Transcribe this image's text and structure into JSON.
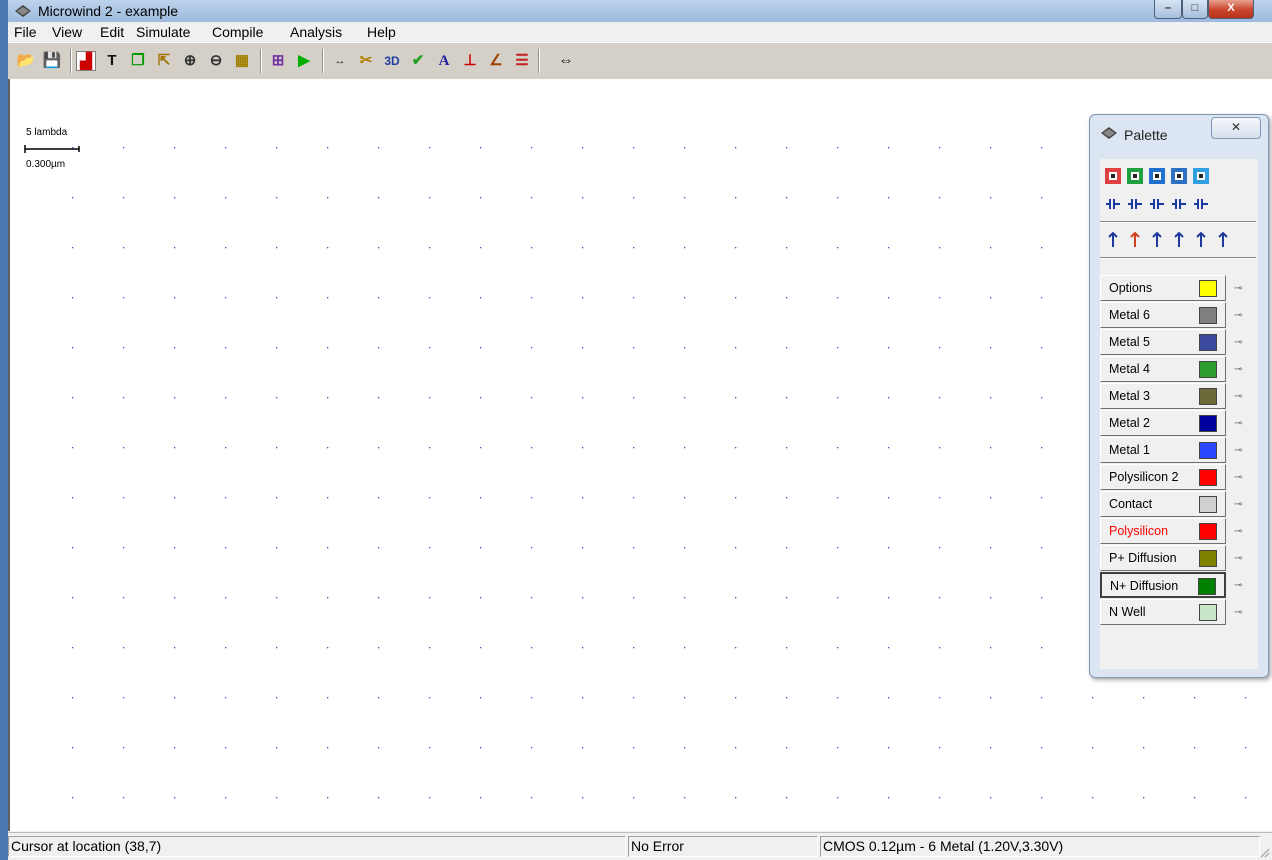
{
  "window": {
    "title": "Microwind 2 - example",
    "min_glyph": "–",
    "max_glyph": "□",
    "close_glyph": "X"
  },
  "menu": {
    "items": [
      "File",
      "View",
      "Edit",
      "Simulate",
      "Compile",
      "Analysis",
      "Help"
    ]
  },
  "toolbar": {
    "buttons": [
      {
        "name": "open-file-icon",
        "glyph": "📂"
      },
      {
        "name": "save-icon",
        "glyph": "💾"
      },
      {
        "name": "draw-box-icon",
        "glyph": "▟"
      },
      {
        "name": "erase-icon",
        "glyph": "T"
      },
      {
        "name": "copy-icon",
        "glyph": "❐"
      },
      {
        "name": "stretch-icon",
        "glyph": "⇱"
      },
      {
        "name": "zoom-in-icon",
        "glyph": "⊕"
      },
      {
        "name": "zoom-out-icon",
        "glyph": "⊖"
      },
      {
        "name": "view-all-icon",
        "glyph": "▦"
      },
      {
        "name": "connect-icon",
        "glyph": "⊞"
      },
      {
        "name": "simulate-icon",
        "glyph": "▶"
      },
      {
        "name": "measure-icon",
        "glyph": "↔"
      },
      {
        "name": "cut-icon",
        "glyph": "✂"
      },
      {
        "name": "view-3d-icon",
        "glyph": "3D"
      },
      {
        "name": "drc-icon",
        "glyph": "✔"
      },
      {
        "name": "text-icon",
        "glyph": "A"
      },
      {
        "name": "cross-section-icon",
        "glyph": "⊥"
      },
      {
        "name": "curve-icon",
        "glyph": "∠"
      },
      {
        "name": "layers-icon",
        "glyph": "☰"
      },
      {
        "name": "move-arrows-icon",
        "glyph": "⇔"
      }
    ],
    "selected": "draw-box-icon"
  },
  "scale": {
    "lambda_label": "5 lambda",
    "um_label": "0.300µm"
  },
  "status": {
    "cursor": "Cursor at location (38,7)",
    "error": "No Error",
    "technology": "CMOS 0.12µm - 6 Metal (1.20V,3.30V)"
  },
  "palette": {
    "title": "Palette",
    "close_glyph": "✕",
    "layers": [
      {
        "label": "Options",
        "color": "#ffff00",
        "label_color": "#000000",
        "selected": false
      },
      {
        "label": "Metal 6",
        "color": "#808080",
        "label_color": "#000000",
        "selected": false
      },
      {
        "label": "Metal 5",
        "color": "#3b4a9c",
        "label_color": "#000000",
        "selected": false
      },
      {
        "label": "Metal 4",
        "color": "#2e9e2e",
        "label_color": "#000000",
        "selected": false
      },
      {
        "label": "Metal 3",
        "color": "#6b6b3a",
        "label_color": "#000000",
        "selected": false
      },
      {
        "label": "Metal 2",
        "color": "#00009c",
        "label_color": "#000000",
        "selected": false
      },
      {
        "label": "Metal 1",
        "color": "#2a48ff",
        "label_color": "#000000",
        "selected": false
      },
      {
        "label": "Polysilicon 2",
        "color": "#ff0000",
        "label_color": "#000000",
        "selected": false
      },
      {
        "label": "Contact",
        "color": "#d0d0d0",
        "label_color": "#000000",
        "selected": false
      },
      {
        "label": "Polysilicon",
        "color": "#ff0000",
        "label_color": "#ff0000",
        "selected": false
      },
      {
        "label": "P+ Diffusion",
        "color": "#808000",
        "label_color": "#000000",
        "selected": false
      },
      {
        "label": "N+ Diffusion",
        "color": "#008000",
        "label_color": "#000000",
        "selected": true
      },
      {
        "label": "N Well",
        "color": "#c8e6c8",
        "label_color": "#000000",
        "selected": false
      }
    ],
    "icon_rows": [
      [
        "pmos-icon",
        "nmos-icon",
        "pmos-high-icon",
        "contact-icon",
        "via-icon"
      ],
      [
        "capacitor-icon",
        "multiplexer-icon",
        "ground-icon",
        "resistor-icon",
        "inductor-icon"
      ],
      [
        "vdd-icon",
        "vss-icon",
        "clock-icon",
        "pulse-icon",
        "sinus-icon",
        "visible-icon"
      ]
    ]
  }
}
